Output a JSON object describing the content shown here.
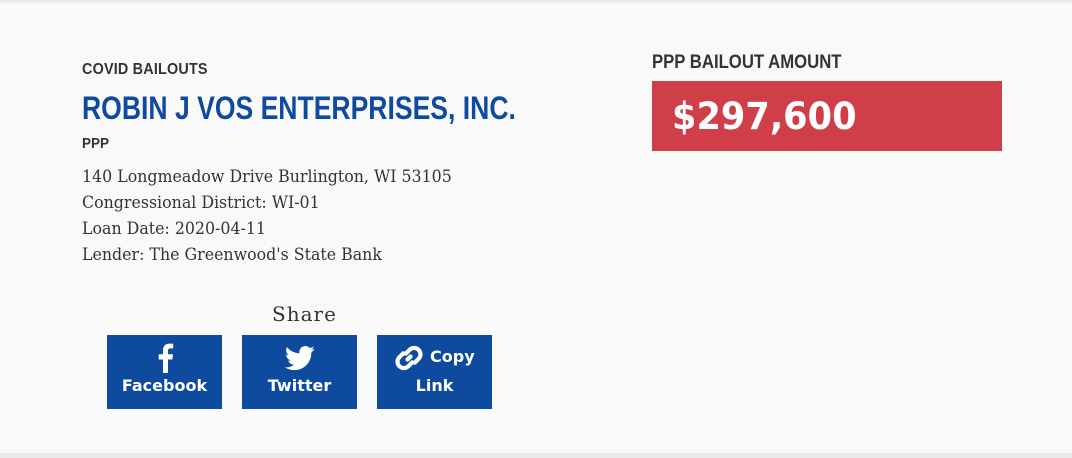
{
  "header": {
    "category": "COVID BAILOUTS",
    "company_name": "ROBIN J VOS ENTERPRISES, INC.",
    "program": "PPP"
  },
  "details": {
    "address": "140 Longmeadow Drive Burlington, WI 53105",
    "district": "Congressional District: WI-01",
    "loan_date": "Loan Date: 2020-04-11",
    "lender": "Lender: The Greenwood's State Bank"
  },
  "share": {
    "title": "Share",
    "facebook_label": "Facebook",
    "twitter_label": "Twitter",
    "copy_label_line1": "Copy",
    "copy_label_line2": "Link"
  },
  "amount": {
    "heading": "PPP BAILOUT AMOUNT",
    "value": "$297,600"
  },
  "colors": {
    "brand_blue": "#0e4a9e",
    "amount_red": "#cf3e49",
    "text_dark": "#333333",
    "background": "#f9f9f9"
  },
  "icons": {
    "facebook": "facebook-icon",
    "twitter": "twitter-icon",
    "copy_link": "link-icon"
  }
}
